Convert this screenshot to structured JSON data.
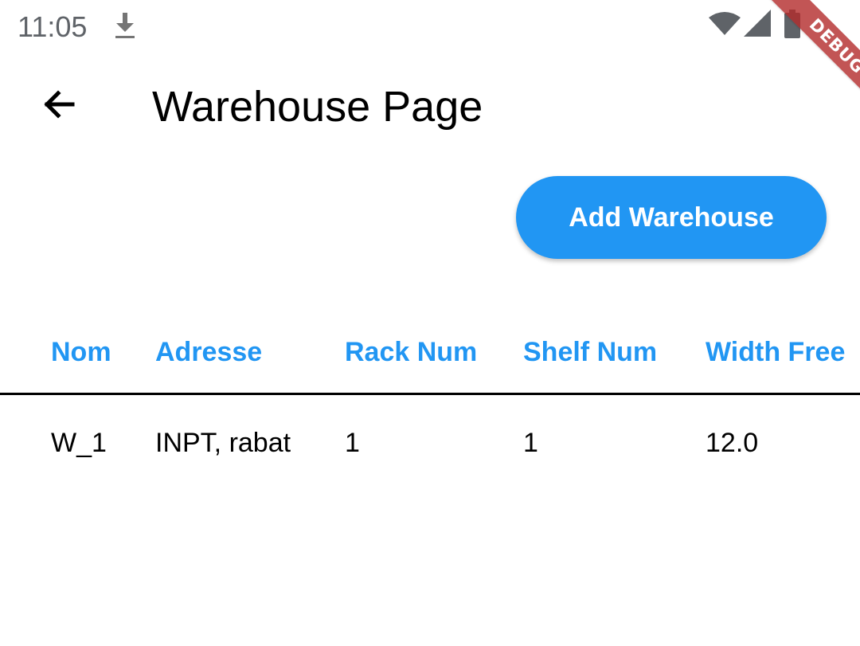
{
  "status_bar": {
    "time": "11:05"
  },
  "debug_banner": {
    "label": "DEBUG"
  },
  "app_bar": {
    "title": "Warehouse Page"
  },
  "add_button": {
    "label": "Add Warehouse"
  },
  "table": {
    "columns": [
      "Nom",
      "Adresse",
      "Rack Num",
      "Shelf Num",
      "Width Free"
    ],
    "rows": [
      [
        "W_1",
        "INPT, rabat",
        "1",
        "1",
        "12.0"
      ]
    ]
  },
  "colors": {
    "accent": "#2196f3",
    "debug_ribbon": "#b32b2b"
  }
}
